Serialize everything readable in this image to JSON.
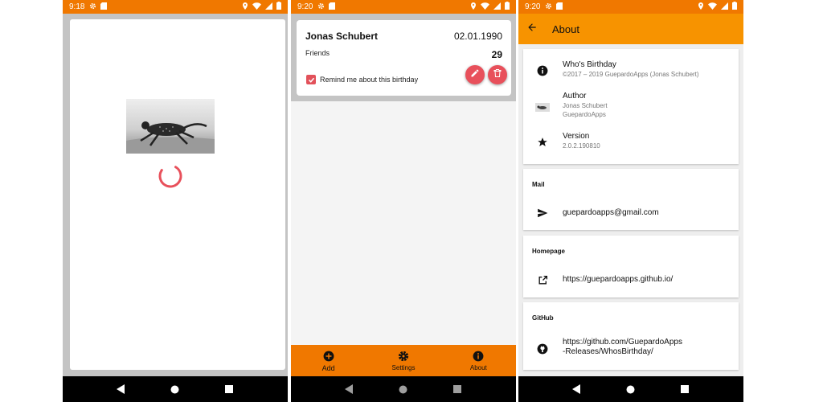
{
  "splash": {
    "status_time": "9:18"
  },
  "detail": {
    "status_time": "9:20",
    "name": "Jonas Schubert",
    "date": "02.01.1990",
    "group": "Friends",
    "age": "29",
    "remind_label": "Remind me about this birthday",
    "remind_checked": true,
    "bottom_nav": [
      {
        "label": "Add",
        "icon": "add-circle-icon"
      },
      {
        "label": "Settings",
        "icon": "gear-icon"
      },
      {
        "label": "About",
        "icon": "info-icon"
      }
    ]
  },
  "about": {
    "status_time": "9:20",
    "title": "About",
    "app_name": "Who's Birthday",
    "copyright": "©2017 – 2019 GuepardoApps (Jonas Schubert)",
    "author_label": "Author",
    "author_name": "Jonas Schubert",
    "author_company": "GuepardoApps",
    "version_label": "Version",
    "version_value": "2.0.2.190810",
    "mail_header": "Mail",
    "mail_value": "guepardoapps@gmail.com",
    "homepage_header": "Homepage",
    "homepage_value": "https://guepardoapps.github.io/",
    "github_header": "GitHub",
    "github_value_line1": "https://github.com/GuepardoApps",
    "github_value_line2": "-Releases/WhosBirthday/"
  },
  "colors": {
    "status_bar": "#f07800",
    "app_bar": "#f79300",
    "accent_red": "#e8505b"
  }
}
